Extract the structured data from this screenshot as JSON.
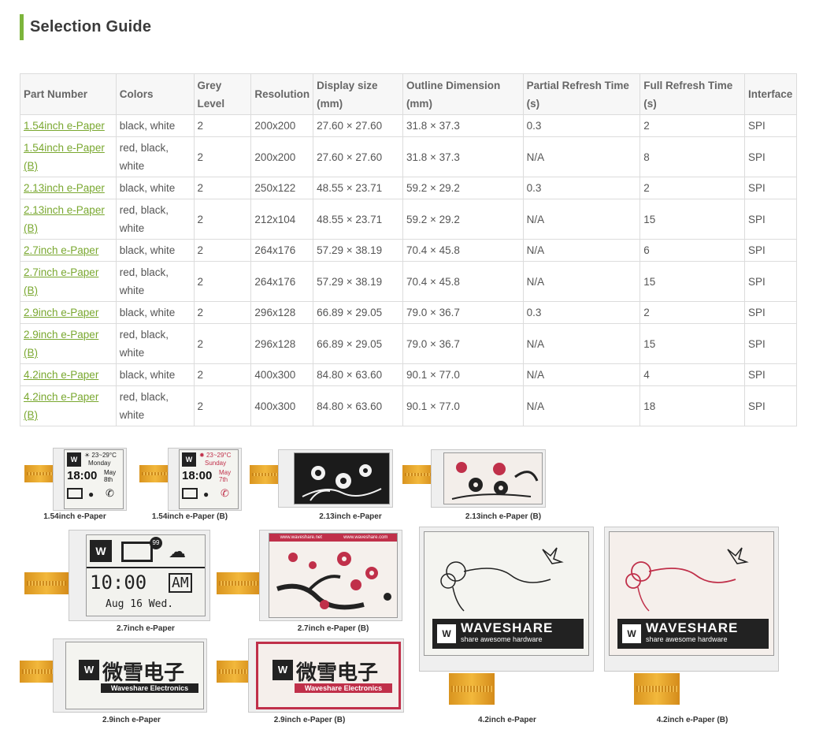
{
  "title": "Selection Guide",
  "table": {
    "headers": [
      {
        "line1": "Part Number",
        "line2": ""
      },
      {
        "line1": "Colors",
        "line2": ""
      },
      {
        "line1": "Grey",
        "line2": "Level"
      },
      {
        "line1": "Resolution",
        "line2": ""
      },
      {
        "line1": "Display size",
        "line2": "(mm)"
      },
      {
        "line1": "Outline Dimension",
        "line2": "(mm)"
      },
      {
        "line1": "Partial Refresh Time",
        "line2": "(s)"
      },
      {
        "line1": "Full Refresh Time",
        "line2": "(s)"
      },
      {
        "line1": "Interface",
        "line2": ""
      }
    ],
    "rows": [
      {
        "part": "1.54inch e-Paper",
        "part2": "",
        "colors": "black, white",
        "colors2": "",
        "grey": "2",
        "res": "200x200",
        "display": "27.60 × 27.60",
        "outline": "31.8 × 37.3",
        "partial": "0.3",
        "full": "2",
        "iface": "SPI"
      },
      {
        "part": "1.54inch e-Paper",
        "part2": "(B)",
        "colors": "red, black,",
        "colors2": "white",
        "grey": "2",
        "res": "200x200",
        "display": "27.60 × 27.60",
        "outline": "31.8 × 37.3",
        "partial": "N/A",
        "full": "8",
        "iface": "SPI"
      },
      {
        "part": "2.13inch e-Paper",
        "part2": "",
        "colors": "black, white",
        "colors2": "",
        "grey": "2",
        "res": "250x122",
        "display": "48.55 × 23.71",
        "outline": "59.2 × 29.2",
        "partial": "0.3",
        "full": "2",
        "iface": "SPI"
      },
      {
        "part": "2.13inch e-Paper",
        "part2": "(B)",
        "colors": "red, black,",
        "colors2": "white",
        "grey": "2",
        "res": "212x104",
        "display": "48.55 × 23.71",
        "outline": "59.2 × 29.2",
        "partial": "N/A",
        "full": "15",
        "iface": "SPI"
      },
      {
        "part": "2.7inch e-Paper",
        "part2": "",
        "colors": "black, white",
        "colors2": "",
        "grey": "2",
        "res": "264x176",
        "display": "57.29 × 38.19",
        "outline": "70.4 × 45.8",
        "partial": "N/A",
        "full": "6",
        "iface": "SPI"
      },
      {
        "part": "2.7inch e-Paper",
        "part2": "(B)",
        "colors": "red, black,",
        "colors2": "white",
        "grey": "2",
        "res": "264x176",
        "display": "57.29 × 38.19",
        "outline": "70.4 × 45.8",
        "partial": "N/A",
        "full": "15",
        "iface": "SPI"
      },
      {
        "part": "2.9inch e-Paper",
        "part2": "",
        "colors": "black, white",
        "colors2": "",
        "grey": "2",
        "res": "296x128",
        "display": "66.89 × 29.05",
        "outline": "79.0 × 36.7",
        "partial": "0.3",
        "full": "2",
        "iface": "SPI"
      },
      {
        "part": "2.9inch e-Paper",
        "part2": "(B)",
        "colors": "red, black,",
        "colors2": "white",
        "grey": "2",
        "res": "296x128",
        "display": "66.89 × 29.05",
        "outline": "79.0 × 36.7",
        "partial": "N/A",
        "full": "15",
        "iface": "SPI"
      },
      {
        "part": "4.2inch e-Paper",
        "part2": "",
        "colors": "black, white",
        "colors2": "",
        "grey": "2",
        "res": "400x300",
        "display": "84.80 × 63.60",
        "outline": "90.1 × 77.0",
        "partial": "N/A",
        "full": "4",
        "iface": "SPI"
      },
      {
        "part": "4.2inch e-Paper",
        "part2": "(B)",
        "colors": "red, black,",
        "colors2": "white",
        "grey": "2",
        "res": "400x300",
        "display": "84.80 × 63.60",
        "outline": "90.1 × 77.0",
        "partial": "N/A",
        "full": "18",
        "iface": "SPI"
      }
    ]
  },
  "gallery": {
    "captions": {
      "p154": "1.54inch e-Paper",
      "p154b": "1.54inch e-Paper (B)",
      "p213": "2.13inch e-Paper",
      "p213b": "2.13inch e-Paper (B)",
      "p27": "2.7inch e-Paper",
      "p27b": "2.7inch e-Paper (B)",
      "p29": "2.9inch e-Paper",
      "p29b": "2.9inch e-Paper (B)",
      "p42": "4.2inch e-Paper",
      "p42b": "4.2inch e-Paper (B)"
    },
    "screen154": {
      "temp": "23~29°C",
      "day": "Monday",
      "time": "18:00",
      "month": "May",
      "date": "8th"
    },
    "screen154b": {
      "temp": "23~29°C",
      "day": "Sunday",
      "time": "18:00",
      "month": "May",
      "date": "7th"
    },
    "screen27": {
      "badge": "99",
      "time": "10:00",
      "ampm": "AM",
      "date": "Aug 16 Wed."
    },
    "screen27b": {
      "site1": "www.waveshare.net",
      "site2": "www.waveshare.com"
    },
    "screen29": {
      "cn": "微雪电子",
      "en": "Waveshare Electronics"
    },
    "screen42": {
      "brand": "WAVESHARE",
      "tagline": "share awesome hardware"
    },
    "colors": {
      "accent": "#7cb53b",
      "link": "#7aa830",
      "red": "#c0304a"
    }
  }
}
